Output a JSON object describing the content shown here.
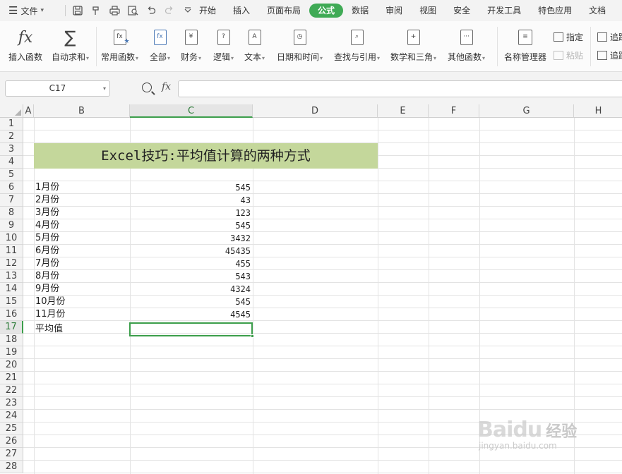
{
  "menu": {
    "file_label": "文件",
    "tabs": [
      "开始",
      "插入",
      "页面布局",
      "公式",
      "数据",
      "审阅",
      "视图",
      "安全",
      "开发工具",
      "特色应用",
      "文档"
    ],
    "active_tab": "公式",
    "accent_color": "#3faa55"
  },
  "quick_access_icons": [
    "save-icon",
    "format-painter-icon",
    "print-icon",
    "print-preview-icon",
    "undo-icon",
    "redo-icon",
    "more-icon"
  ],
  "ribbon": {
    "insert_function": "插入函数",
    "autosum": "自动求和",
    "common_functions": "常用函数",
    "all": "全部",
    "financial": "财务",
    "logical": "逻辑",
    "text": "文本",
    "datetime": "日期和时间",
    "lookup": "查找与引用",
    "math": "数学和三角",
    "other": "其他函数",
    "name_manager": "名称管理器",
    "define": "指定",
    "paste": "粘贴",
    "trace1": "追踪",
    "trace2": "追踪"
  },
  "formula_bar": {
    "name_box": "C17",
    "fx_label": "fx",
    "formula": ""
  },
  "grid": {
    "columns": [
      "A",
      "B",
      "C",
      "D",
      "E",
      "F",
      "G",
      "H"
    ],
    "selected_column": "C",
    "rows": [
      "1",
      "2",
      "3",
      "4",
      "5",
      "6",
      "7",
      "8",
      "9",
      "10",
      "11",
      "12",
      "13",
      "14",
      "15",
      "16",
      "17",
      "18",
      "19",
      "20",
      "21",
      "22",
      "23",
      "24",
      "25",
      "26",
      "27",
      "28"
    ],
    "selected_row": "17",
    "title": "Excel技巧:平均值计算的两种方式",
    "title_bg": "#c4d79b",
    "months": [
      "1月份",
      "2月份",
      "3月份",
      "4月份",
      "5月份",
      "6月份",
      "7月份",
      "8月份",
      "9月份",
      "10月份",
      "11月份"
    ],
    "values": [
      "545",
      "43",
      "123",
      "545",
      "3432",
      "45435",
      "455",
      "543",
      "4324",
      "545",
      "4545"
    ],
    "average_label": "平均值",
    "active_cell_value": ""
  },
  "watermark": {
    "brand": "Baidu",
    "brand_cn": "经验",
    "url": "jingyan.baidu.com"
  }
}
